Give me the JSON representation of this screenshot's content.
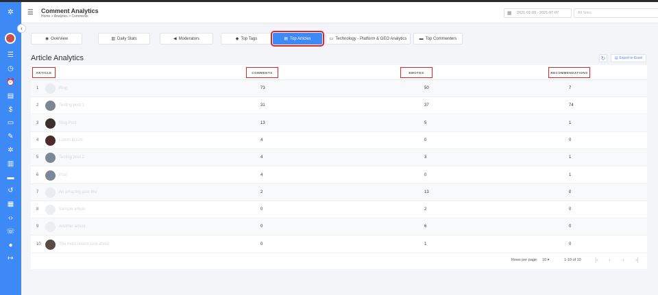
{
  "header": {
    "title": "Comment Analytics",
    "breadcrumb": "Home > Analytics > Comments",
    "date_range": "2021-01-09 - 2021-07-07",
    "site_placeholder": "All Sites"
  },
  "sidebar": {
    "collapse_glyph": "‹",
    "icons": [
      "list-icon",
      "clock-icon",
      "alarm-icon",
      "book-icon",
      "dollar-icon",
      "id-card-icon",
      "pencil-icon",
      "gear-icon",
      "chart-icon",
      "card-icon",
      "history-icon",
      "table-icon",
      "code-icon",
      "headset-icon",
      "chat-icon",
      "logout-icon"
    ]
  },
  "tabs": [
    {
      "label": "Overview",
      "icon": "eye-icon",
      "active": false
    },
    {
      "label": "Daily Stats",
      "icon": "bar-chart-icon",
      "active": false
    },
    {
      "label": "Moderators",
      "icon": "megaphone-icon",
      "active": false
    },
    {
      "label": "Top Tags",
      "icon": "tag-icon",
      "active": false
    },
    {
      "label": "Top Articles",
      "icon": "document-icon",
      "active": true
    },
    {
      "label": "Technology - Platform & GEO Analytics",
      "icon": "laptop-icon",
      "active": false
    },
    {
      "label": "Top Commenters",
      "icon": "speech-icon",
      "active": false
    }
  ],
  "section": {
    "title": "Article Analytics",
    "export_label": "Export to Excel"
  },
  "table": {
    "headers": {
      "article": "ARTICLE",
      "comments": "COMMENTS",
      "emotes": "EMOTES",
      "recommendations": "RECOMMENDATIONS"
    },
    "rows": [
      {
        "num": "1",
        "title": "Blog",
        "comments": "73",
        "emotes": "50",
        "recommendations": "7",
        "thumb": "#e8ebf0"
      },
      {
        "num": "2",
        "title": "Testing post 1",
        "comments": "31",
        "emotes": "37",
        "recommendations": "74",
        "thumb": "#7d8796"
      },
      {
        "num": "3",
        "title": "Blog Post",
        "comments": "13",
        "emotes": "5",
        "recommendations": "1",
        "thumb": "#3a2f2f"
      },
      {
        "num": "4",
        "title": "Lorem ipsum",
        "comments": "4",
        "emotes": "0",
        "recommendations": "0",
        "thumb": "#4a2a2a"
      },
      {
        "num": "5",
        "title": "Testing post 2",
        "comments": "4",
        "emotes": "3",
        "recommendations": "1",
        "thumb": "#7d8796"
      },
      {
        "num": "6",
        "title": "Post",
        "comments": "4",
        "emotes": "0",
        "recommendations": "1",
        "thumb": "#7d8796"
      },
      {
        "num": "7",
        "title": "An amazing post title",
        "comments": "2",
        "emotes": "13",
        "recommendations": "0",
        "thumb": "#e8ebf0"
      },
      {
        "num": "8",
        "title": "Sample article",
        "comments": "0",
        "emotes": "2",
        "recommendations": "0",
        "thumb": "#eceef2"
      },
      {
        "num": "9",
        "title": "Another article",
        "comments": "0",
        "emotes": "6",
        "recommendations": "0",
        "thumb": "#eceef2"
      },
      {
        "num": "10",
        "title": "The most recent post about",
        "comments": "0",
        "emotes": "1",
        "recommendations": "0",
        "thumb": "#5a4a44"
      }
    ]
  },
  "pager": {
    "rows_per_page_label": "Rows per page:",
    "rows_per_page": "10",
    "range": "1-10 of 10",
    "first": "|‹",
    "prev": "‹",
    "next": "›",
    "last": "›|"
  },
  "colors": {
    "accent": "#3d8af7",
    "highlight": "#e02424"
  }
}
